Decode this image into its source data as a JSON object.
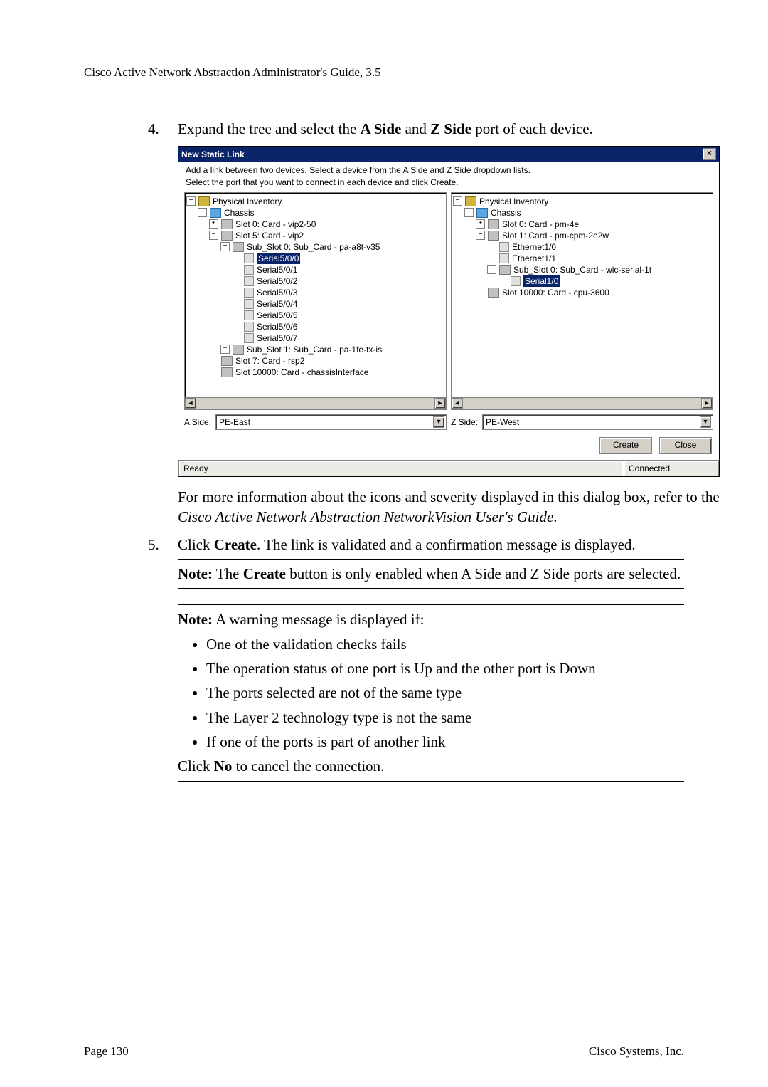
{
  "doc": {
    "header": "Cisco Active Network Abstraction Administrator's Guide, 3.5",
    "page_label": "Page 130",
    "company": "Cisco Systems, Inc."
  },
  "steps": {
    "s4": {
      "num": "4.",
      "pre": "Expand the tree and select the ",
      "b1": "A Side",
      "mid": " and ",
      "b2": "Z Side",
      "post": " port of each device."
    },
    "s4_after": {
      "p1a": "For more information about the icons and severity displayed in this dialog box, refer to the ",
      "p1i": "Cisco Active Network Abstraction NetworkVision User's Guide",
      "p1b": "."
    },
    "s5": {
      "num": "5.",
      "pre": "Click ",
      "b1": "Create",
      "post": ". The link is validated and a confirmation message is displayed."
    },
    "note1": {
      "lead": "Note:",
      "t1": " The ",
      "b": "Create",
      "t2": " button is only enabled when A Side and Z Side ports are selected."
    },
    "note2": {
      "lead": "Note:",
      "intro": " A warning message is displayed if:",
      "bul": [
        "One of the validation checks fails",
        "The operation status of one port is Up and the other port is Down",
        "The ports selected are not of the same type",
        "The Layer 2 technology type is not the same",
        "If one of the ports is part of another link"
      ],
      "after_pre": "Click ",
      "after_b": "No",
      "after_post": " to cancel the connection."
    }
  },
  "win": {
    "title": "New Static Link",
    "close": "×",
    "instr1": "Add a link between two devices. Select a device from the A Side and Z Side dropdown lists.",
    "instr2": "Select the port that you want to connect in each device and click Create.",
    "left_tree": {
      "n0": "Physical Inventory",
      "n1": "Chassis",
      "n2": "Slot 0: Card - vip2-50",
      "n3": "Slot 5: Card - vip2",
      "n4": "Sub_Slot 0: Sub_Card - pa-a8t-v35",
      "n5": "Serial5/0/0",
      "n6": "Serial5/0/1",
      "n7": "Serial5/0/2",
      "n8": "Serial5/0/3",
      "n9": "Serial5/0/4",
      "n10": "Serial5/0/5",
      "n11": "Serial5/0/6",
      "n12": "Serial5/0/7",
      "n13": "Sub_Slot 1: Sub_Card - pa-1fe-tx-isl",
      "n14": "Slot 7: Card - rsp2",
      "n15": "Slot 10000: Card - chassisInterface"
    },
    "right_tree": {
      "n0": "Physical Inventory",
      "n1": "Chassis",
      "n2": "Slot 0: Card - pm-4e",
      "n3": "Slot 1: Card - pm-cpm-2e2w",
      "n4": "Ethernet1/0",
      "n5": "Ethernet1/1",
      "n6": "Sub_Slot 0: Sub_Card - wic-serial-1t",
      "n7": "Serial1/0",
      "n8": "Slot 10000: Card - cpu-3600"
    },
    "aside_label": "A Side:",
    "aside_val": "PE-East",
    "zside_label": "Z Side:",
    "zside_val": "PE-West",
    "btn_create": "Create",
    "btn_close": "Close",
    "status_ready": "Ready",
    "status_conn": "Connected"
  }
}
